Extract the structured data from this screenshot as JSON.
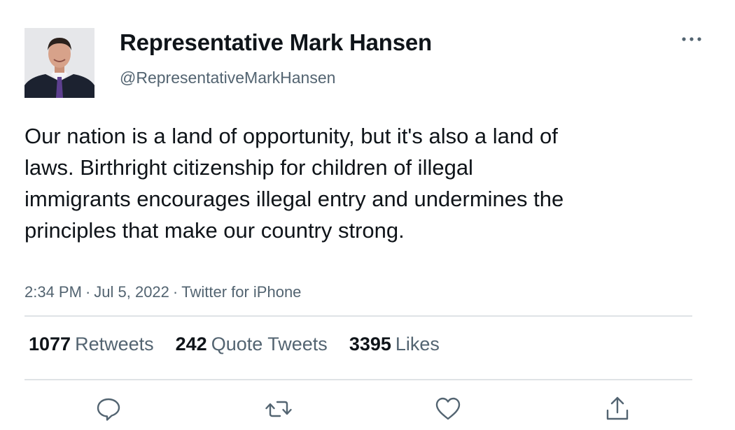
{
  "author": {
    "name": "Representative Mark Hansen",
    "handle": "@RepresentativeMarkHansen"
  },
  "tweet": {
    "text": "Our nation is a land of opportunity, but it's also a land of laws. Birthright citizenship for children of illegal immigrants encourages illegal entry and undermines the principles that make our country strong.",
    "time": "2:34 PM",
    "date": "Jul 5, 2022",
    "source": "Twitter for iPhone",
    "separator": "·"
  },
  "stats": {
    "retweets_count": "1077",
    "retweets_label": "Retweets",
    "quotes_count": "242",
    "quotes_label": "Quote Tweets",
    "likes_count": "3395",
    "likes_label": "Likes"
  },
  "icons": {
    "more": "more-dots-icon",
    "reply": "reply-bubble-icon",
    "retweet": "retweet-arrows-icon",
    "like": "heart-icon",
    "share": "share-upload-icon"
  },
  "colors": {
    "text": "#0f1419",
    "secondary": "#536471",
    "divider": "#dfe3e6"
  }
}
